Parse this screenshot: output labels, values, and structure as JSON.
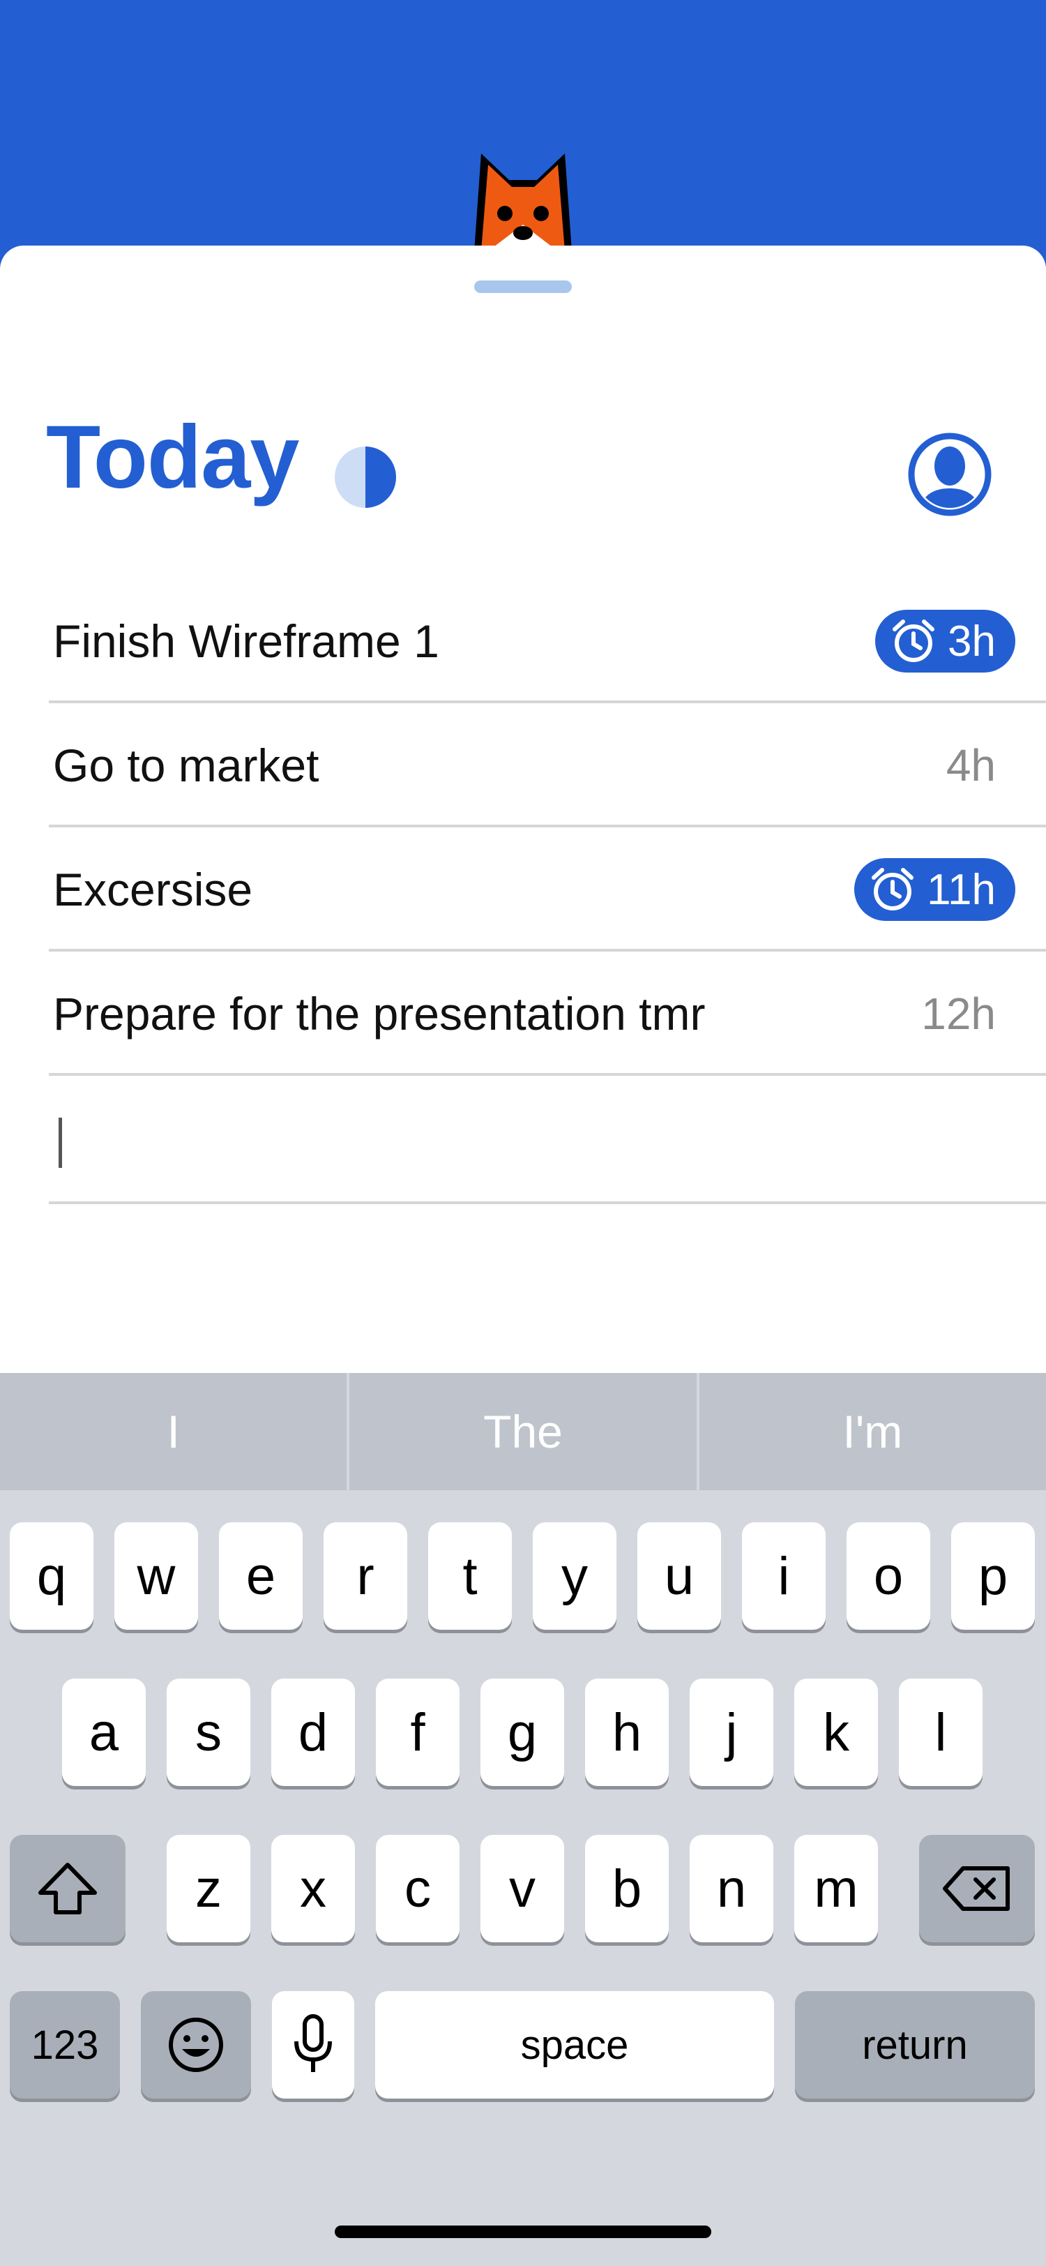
{
  "header": {
    "mascot": "fox-icon",
    "background_color": "#235fd2"
  },
  "sheet": {
    "title": "Today",
    "title_color": "#235fd2",
    "progress_icon": "half-circle-icon",
    "profile_icon": "user-avatar-icon"
  },
  "tasks": [
    {
      "label": "Finish Wireframe 1",
      "time": "3h",
      "alarm": true
    },
    {
      "label": "Go to market",
      "time": "4h",
      "alarm": false
    },
    {
      "label": "Excersise",
      "time": "11h",
      "alarm": true
    },
    {
      "label": "Prepare for the presentation tmr",
      "time": "12h",
      "alarm": false
    }
  ],
  "new_task_input": {
    "value": ""
  },
  "keyboard": {
    "suggestions": [
      "I",
      "The",
      "I'm"
    ],
    "row1": [
      "q",
      "w",
      "e",
      "r",
      "t",
      "y",
      "u",
      "i",
      "o",
      "p"
    ],
    "row2": [
      "a",
      "s",
      "d",
      "f",
      "g",
      "h",
      "j",
      "k",
      "l"
    ],
    "row3": [
      "z",
      "x",
      "c",
      "v",
      "b",
      "n",
      "m"
    ],
    "numbers_label": "123",
    "space_label": "space",
    "return_label": "return",
    "shift_icon": "shift-icon",
    "backspace_icon": "backspace-icon",
    "emoji_icon": "emoji-icon",
    "mic_icon": "microphone-icon"
  }
}
